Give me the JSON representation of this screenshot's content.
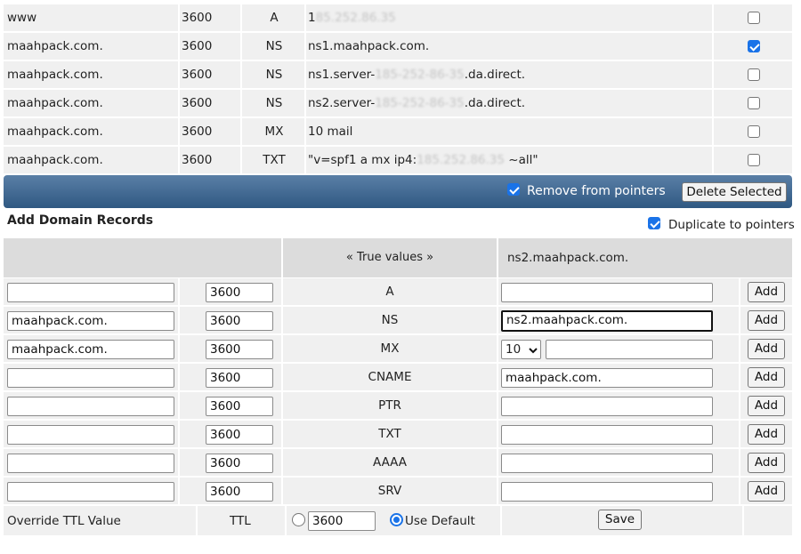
{
  "records": [
    {
      "name": "www",
      "ttl": "3600",
      "type": "A",
      "value_prefix": "1",
      "value_blur": "85.252.86.35",
      "value_suffix": "",
      "checked": false
    },
    {
      "name": "maahpack.com.",
      "ttl": "3600",
      "type": "NS",
      "value_prefix": "ns1.maahpack.com.",
      "value_blur": "",
      "value_suffix": "",
      "checked": true
    },
    {
      "name": "maahpack.com.",
      "ttl": "3600",
      "type": "NS",
      "value_prefix": "ns1.server-",
      "value_blur": "185-252-86-35",
      "value_suffix": ".da.direct.",
      "checked": false
    },
    {
      "name": "maahpack.com.",
      "ttl": "3600",
      "type": "NS",
      "value_prefix": "ns2.server-",
      "value_blur": "185-252-86-35",
      "value_suffix": ".da.direct.",
      "checked": false
    },
    {
      "name": "maahpack.com.",
      "ttl": "3600",
      "type": "MX",
      "value_prefix": "10 mail",
      "value_blur": "",
      "value_suffix": "",
      "checked": false
    },
    {
      "name": "maahpack.com.",
      "ttl": "3600",
      "type": "TXT",
      "value_prefix": "\"v=spf1 a mx ip4:",
      "value_blur": "185.252.86.35",
      "value_suffix": " ~all\"",
      "checked": false
    }
  ],
  "actions": {
    "remove_from_pointers_label": "Remove from pointers",
    "remove_from_pointers_checked": true,
    "delete_selected_label": "Delete Selected"
  },
  "add_section": {
    "title": "Add Domain Records",
    "duplicate_label": "Duplicate to pointers",
    "duplicate_checked": true,
    "header_true_values": "« True values »",
    "header_target": "ns2.maahpack.com.",
    "add_label": "Add",
    "rows": [
      {
        "name": "",
        "ttl": "3600",
        "type": "A",
        "value": ""
      },
      {
        "name": "maahpack.com.",
        "ttl": "3600",
        "type": "NS",
        "value": "ns2.maahpack.com."
      },
      {
        "name": "maahpack.com.",
        "ttl": "3600",
        "type": "MX",
        "priority": "10",
        "value": ""
      },
      {
        "name": "",
        "ttl": "3600",
        "type": "CNAME",
        "value": "maahpack.com."
      },
      {
        "name": "",
        "ttl": "3600",
        "type": "PTR",
        "value": ""
      },
      {
        "name": "",
        "ttl": "3600",
        "type": "TXT",
        "value": ""
      },
      {
        "name": "",
        "ttl": "3600",
        "type": "AAAA",
        "value": ""
      },
      {
        "name": "",
        "ttl": "3600",
        "type": "SRV",
        "value": ""
      }
    ]
  },
  "override": {
    "label": "Override TTL Value",
    "ttl_label": "TTL",
    "ttl_value": "3600",
    "use_default_label": "Use Default",
    "use_default_selected": true,
    "save_label": "Save"
  },
  "colors": {
    "accent": "#1a73e8",
    "bar_top": "#5a7fa6",
    "bar_bottom": "#2f5882",
    "row_bg": "#f0f0f0",
    "header_bg": "#dcdcdc"
  }
}
